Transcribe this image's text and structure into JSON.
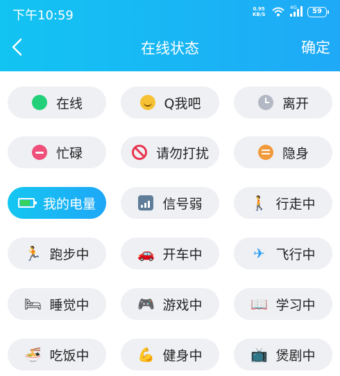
{
  "status_bar": {
    "time": "下午10:59",
    "net_speed_value": "0.95",
    "net_speed_unit": "KB/S",
    "signal_label": "4G",
    "battery": "59"
  },
  "header": {
    "title": "在线状态",
    "confirm_label": "确定",
    "background": "#1fb8f5"
  },
  "statuses": [
    {
      "label": "在线",
      "icon": "green-dot-icon",
      "selected": false
    },
    {
      "label": "Q我吧",
      "icon": "smile-face-icon",
      "selected": false
    },
    {
      "label": "离开",
      "icon": "clock-icon",
      "selected": false
    },
    {
      "label": "忙碌",
      "icon": "busy-minus-icon",
      "selected": false
    },
    {
      "label": "请勿打扰",
      "icon": "no-entry-icon",
      "selected": false
    },
    {
      "label": "隐身",
      "icon": "invisible-icon",
      "selected": false
    },
    {
      "label": "我的电量",
      "icon": "battery-icon",
      "selected": true
    },
    {
      "label": "信号弱",
      "icon": "signal-weak-icon",
      "selected": false
    },
    {
      "label": "行走中",
      "icon": "walking-icon",
      "selected": false
    },
    {
      "label": "跑步中",
      "icon": "running-icon",
      "selected": false
    },
    {
      "label": "开车中",
      "icon": "car-icon",
      "selected": false
    },
    {
      "label": "飞行中",
      "icon": "airplane-icon",
      "selected": false
    },
    {
      "label": "睡觉中",
      "icon": "bed-icon",
      "selected": false
    },
    {
      "label": "游戏中",
      "icon": "gamepad-icon",
      "selected": false
    },
    {
      "label": "学习中",
      "icon": "book-icon",
      "selected": false
    },
    {
      "label": "吃饭中",
      "icon": "rice-bowl-icon",
      "selected": false
    },
    {
      "label": "健身中",
      "icon": "flexed-biceps-icon",
      "selected": false
    },
    {
      "label": "煲剧中",
      "icon": "tv-icon",
      "selected": false
    }
  ],
  "colors": {
    "accent": "#1eaef6",
    "chip_bg": "#eff0f4",
    "online_green": "#22d07a"
  }
}
